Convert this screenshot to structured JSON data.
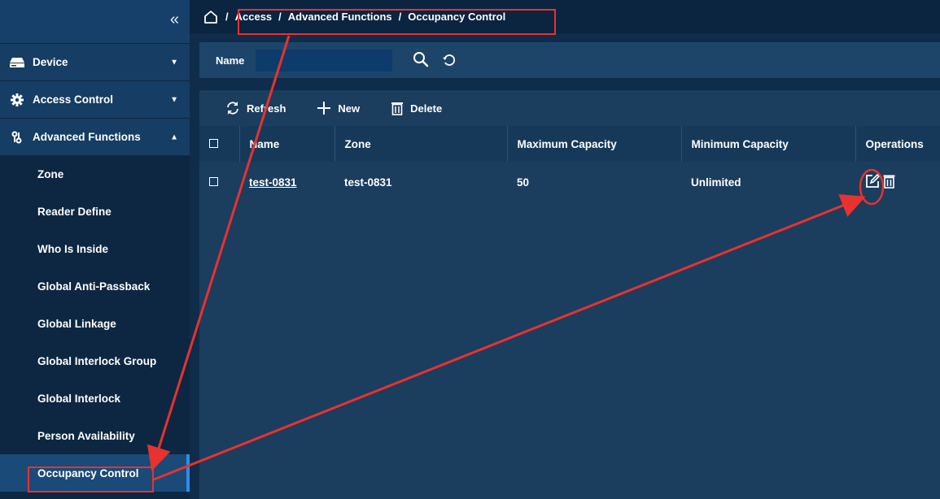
{
  "sidebar": {
    "collapse_icon": "double-chevron-left-icon",
    "groups": [
      {
        "label": "Device",
        "icon": "device-icon",
        "chevron": "chevron-down"
      },
      {
        "label": "Access Control",
        "icon": "gear-icon",
        "chevron": "chevron-down"
      },
      {
        "label": "Advanced Functions",
        "icon": "functions-icon",
        "chevron": "chevron-up"
      }
    ],
    "items": [
      {
        "label": "Zone"
      },
      {
        "label": "Reader Define"
      },
      {
        "label": "Who Is Inside"
      },
      {
        "label": "Global Anti-Passback"
      },
      {
        "label": "Global Linkage"
      },
      {
        "label": "Global Interlock Group"
      },
      {
        "label": "Global Interlock"
      },
      {
        "label": "Person Availability"
      },
      {
        "label": "Occupancy Control",
        "active": true
      }
    ]
  },
  "breadcrumb": {
    "separator": "/",
    "items": [
      "Access",
      "Advanced Functions",
      "Occupancy Control"
    ]
  },
  "search": {
    "label": "Name",
    "value": "",
    "placeholder": ""
  },
  "toolbar": {
    "refresh_label": "Refresh",
    "new_label": "New",
    "delete_label": "Delete"
  },
  "table": {
    "headers": [
      "Name",
      "Zone",
      "Maximum Capacity",
      "Minimum Capacity",
      "Operations"
    ],
    "rows": [
      {
        "name": "test-0831",
        "zone": "test-0831",
        "max": "50",
        "min": "Unlimited"
      }
    ]
  },
  "colors": {
    "background": "#0f2c4a",
    "sidebar": "#0d2742",
    "active_item": "#1a4a78",
    "accent": "#2f8de4",
    "annotation": "#e8322e"
  }
}
